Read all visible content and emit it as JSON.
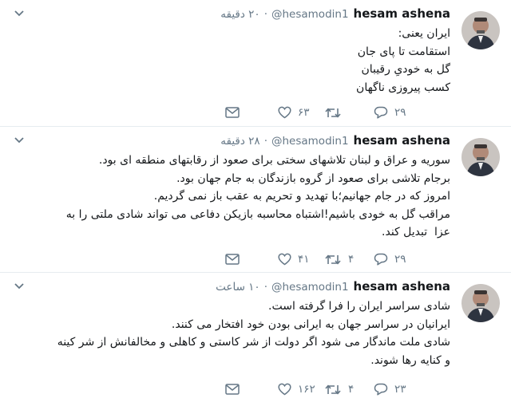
{
  "author": {
    "name": "hesam ashena",
    "handle": "@hesamodin1"
  },
  "tweets": [
    {
      "time": "۲۰ دقیقه",
      "lines": [
        "ایران یعنی:",
        "استقامت تا پای جان",
        "گل به خودیِ رقیبان",
        "کسب پیروزی ناگهان"
      ],
      "replies": "۲۹",
      "retweets": "",
      "likes": "۶۳"
    },
    {
      "time": "۲۸ دقیقه",
      "lines": [
        "سوریه و عراق و لبنان تلاشهای سختی برای صعود از رقابتهای منطقه ای بود.",
        "برجام تلاشی برای صعود از گروه بازندگان به جام جهان بود.",
        "امروز که در جام جهانیم؛با تهدید و تحریم به عقب باز نمی گردیم.",
        "مراقب گل به خودی باشیم!اشتباه محاسبه بازیکن دفاعی می تواند شادی ملتی را به عزا  تبدیل کند."
      ],
      "replies": "۲۹",
      "retweets": "۴",
      "likes": "۴۱"
    },
    {
      "time": "۱۰ ساعت",
      "lines": [
        "شادی سراسر ایران را فرا گرفته است.",
        "ایرانیان در سراسر جهان به ایرانی بودن خود افتخار می کنند.",
        "شادی ملت ماندگار می شود اگر دولت از شر کاستی و کاهلی و مخالفانش از شر کینه و کنایه رها شوند."
      ],
      "replies": "۲۳",
      "retweets": "۴",
      "likes": "۱۶۲"
    }
  ],
  "colors": {
    "text": "#14171a",
    "muted": "#657786",
    "divider": "#e6ecf0"
  },
  "icons": {
    "reply": "reply-icon",
    "retweet": "retweet-icon",
    "like": "heart-icon",
    "dm": "envelope-icon",
    "more": "chevron-down-icon"
  }
}
